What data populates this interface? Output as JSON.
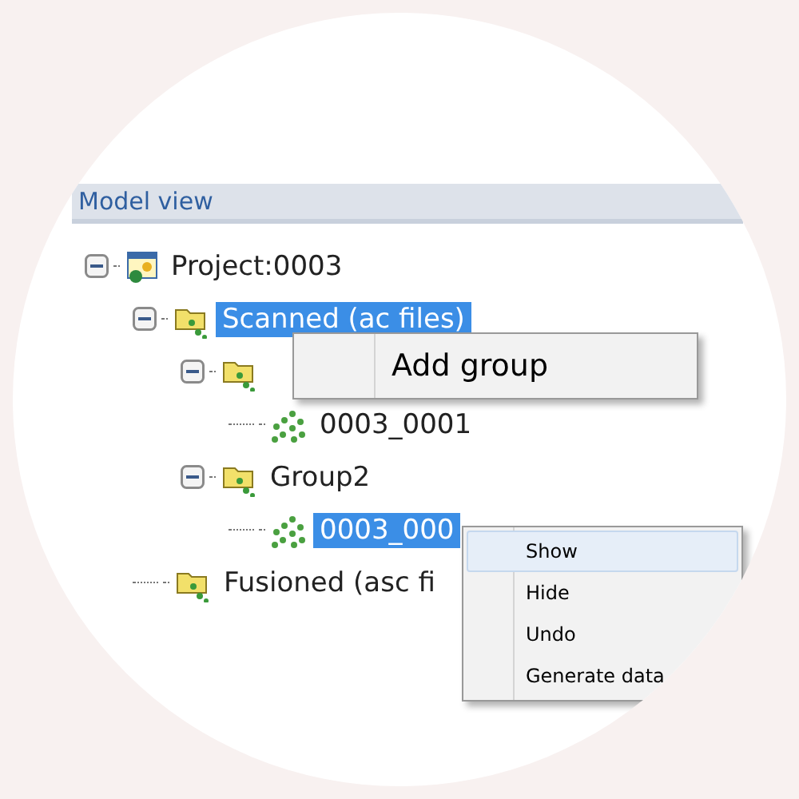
{
  "panel": {
    "title": "Model view"
  },
  "tree": [
    {
      "label": "Project:0003",
      "kind": "project",
      "expanded": true,
      "selected": false,
      "children": [
        {
          "label": "Scanned (ac files)",
          "kind": "folder",
          "expanded": true,
          "selected": true,
          "children": [
            {
              "kind": "folder",
              "expanded": true,
              "children": [
                {
                  "label": "0003_0001",
                  "kind": "cloud",
                  "selected": false
                }
              ]
            },
            {
              "label": "Group2",
              "kind": "folder",
              "expanded": true,
              "selected": false,
              "children": [
                {
                  "label": "0003_000",
                  "kind": "cloud",
                  "selected": true
                }
              ]
            }
          ]
        },
        {
          "label": "Fusioned (asc fi",
          "kind": "folder",
          "selected": false
        }
      ]
    }
  ],
  "context_menus": [
    {
      "items": [
        {
          "label": "Add group",
          "selected": false
        }
      ]
    },
    {
      "items": [
        {
          "label": "Show",
          "selected": true
        },
        {
          "label": "Hide",
          "selected": false
        },
        {
          "label": "Undo",
          "selected": false
        },
        {
          "label": "Generate data",
          "selected": false
        }
      ]
    }
  ]
}
